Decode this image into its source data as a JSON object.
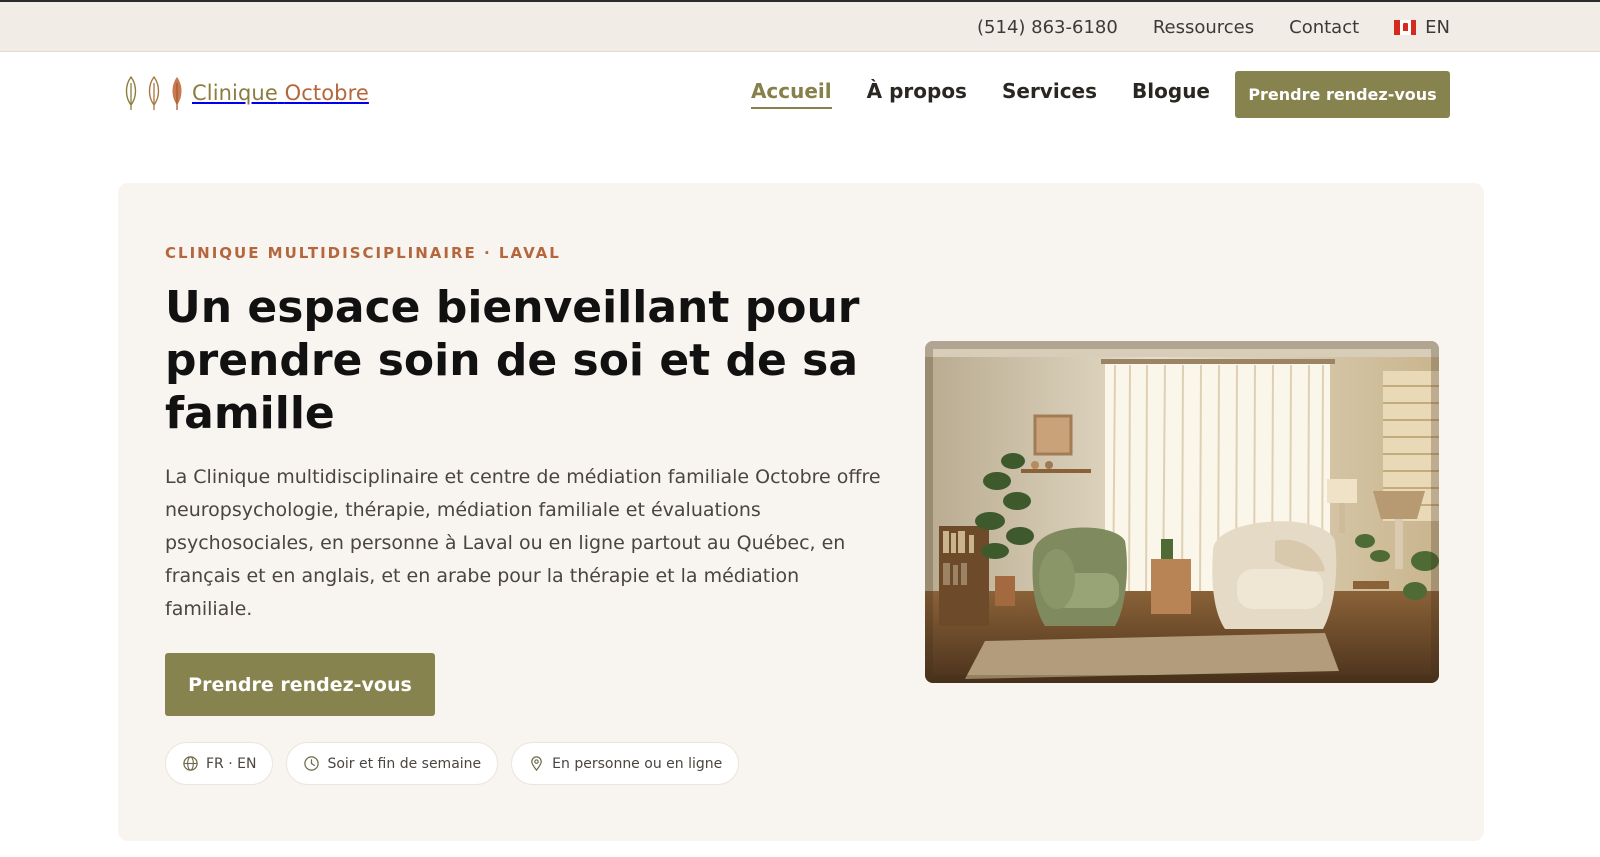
{
  "topbar": {
    "phone": "(514) 863-6180",
    "resources": "Ressources",
    "contact": "Contact",
    "language": "EN"
  },
  "brand": {
    "name_part1": "Clinique",
    "name_part2": "Octobre"
  },
  "nav": {
    "items": [
      {
        "label": "Accueil",
        "active": true
      },
      {
        "label": "À propos",
        "active": false
      },
      {
        "label": "Services",
        "active": false
      },
      {
        "label": "Blogue",
        "active": false
      }
    ],
    "cta": "Prendre rendez-vous"
  },
  "hero": {
    "eyebrow": "CLINIQUE MULTIDISCIPLINAIRE · LAVAL",
    "title": "Un espace bienveillant pour prendre soin de soi et de sa famille",
    "description": "La Clinique multidisciplinaire et centre de médiation familiale Octobre offre neuropsychologie, thérapie, médiation familiale et évaluations psychosociales, en personne à Laval ou en ligne partout au Québec, en français et en anglais, et en arabe pour la thérapie et la médiation familiale.",
    "cta": "Prendre rendez-vous",
    "chips": [
      {
        "icon": "globe-icon",
        "label": "FR · EN"
      },
      {
        "icon": "clock-icon",
        "label": "Soir et fin de semaine"
      },
      {
        "icon": "map-pin-icon",
        "label": "En personne ou en ligne"
      }
    ]
  },
  "colors": {
    "accent": "#87834f",
    "brand_orange": "#b5663c",
    "topbar_bg": "#f1ece6",
    "hero_bg": "#f8f4f0"
  }
}
